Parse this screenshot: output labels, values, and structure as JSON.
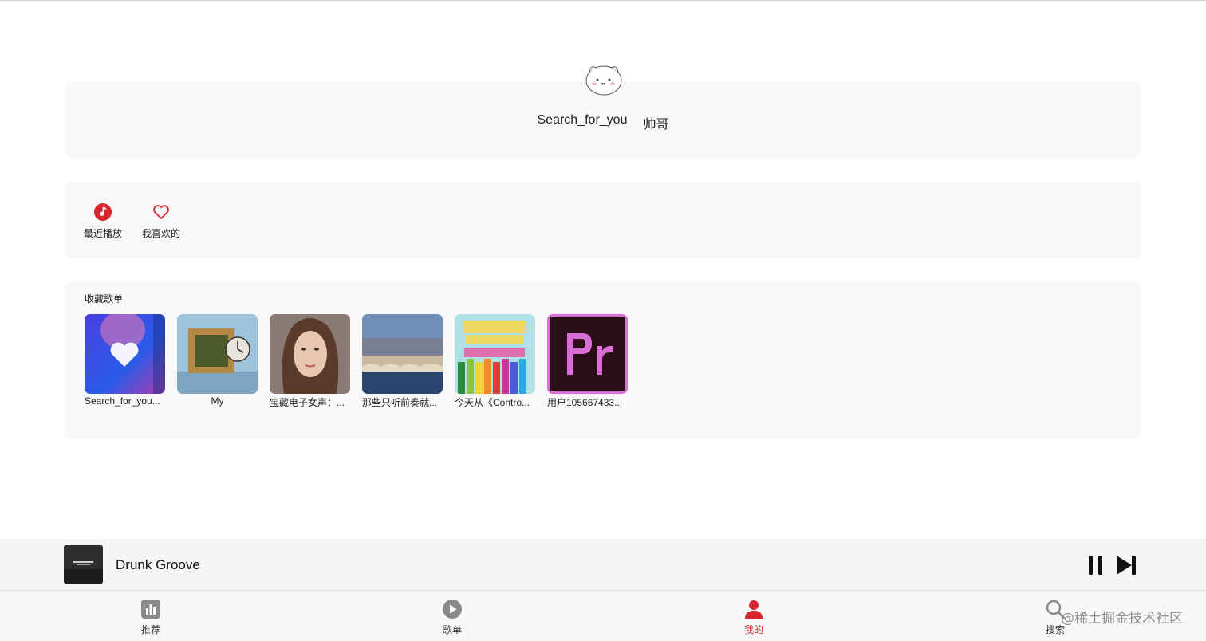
{
  "profile": {
    "username": "Search_for_you",
    "nickname": "帅哥",
    "avatar_icon": "cartoon-cat-avatar"
  },
  "quick_actions": [
    {
      "label": "最近播放",
      "icon": "music-note-icon"
    },
    {
      "label": "我喜欢的",
      "icon": "heart-icon"
    }
  ],
  "collected_playlists": {
    "title": "收藏歌单",
    "items": [
      {
        "name": "Search_for_you..."
      },
      {
        "name": "My"
      },
      {
        "name": "宝藏电子女声：..."
      },
      {
        "name": "那些只听前奏就..."
      },
      {
        "name": "今天从《Contro..."
      },
      {
        "name": "用户105667433..."
      }
    ]
  },
  "player": {
    "title": "Drunk Groove",
    "controls": [
      "pause-icon",
      "next-icon"
    ]
  },
  "tabs": [
    {
      "label": "推荐",
      "icon": "chart-bars-icon",
      "active": false
    },
    {
      "label": "歌单",
      "icon": "play-circle-icon",
      "active": false
    },
    {
      "label": "我的",
      "icon": "user-icon",
      "active": true
    },
    {
      "label": "搜索",
      "icon": "search-icon",
      "active": false
    }
  ],
  "watermark": "@稀土掘金技术社区",
  "colors": {
    "accent": "#d8262f",
    "card_bg": "#f8f8f8",
    "player_bg": "#f5f5f5",
    "tabbar_bg": "#f7f7f7"
  }
}
